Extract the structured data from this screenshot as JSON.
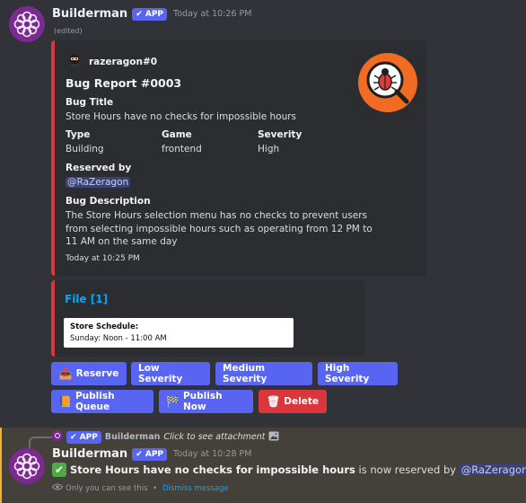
{
  "message1": {
    "author": "Builderman",
    "app_badge": "APP",
    "timestamp": "Today at 10:26 PM",
    "edited": "(edited)"
  },
  "embed": {
    "author": "razeragon#0",
    "title": "Bug Report #0003",
    "bug_title_label": "Bug Title",
    "bug_title_value": "Store Hours have no checks for impossible hours",
    "type_label": "Type",
    "type_value": "Building",
    "game_label": "Game",
    "game_value": "frontend",
    "severity_label": "Severity",
    "severity_value": "High",
    "reserved_label": "Reserved by",
    "reserved_value": "@RaZeragon",
    "desc_label": "Bug Description",
    "desc_line1": "The Store Hours selection menu has no checks to prevent users",
    "desc_line2": "from selecting impossible hours such as operating from 12 PM to",
    "desc_line3": "11 AM on the same day",
    "footer": "Today at 10:25 PM",
    "accent": "#da373c"
  },
  "file_embed": {
    "title": "File [1]",
    "schedule_title": "Store Schedule:",
    "schedule_line": "Sunday: Noon - 11:00 AM"
  },
  "buttons": {
    "reserve": "Reserve",
    "low": "Low Severity",
    "medium": "Medium Severity",
    "high": "High Severity",
    "publish_queue": "Publish Queue",
    "publish_now": "Publish Now",
    "delete": "Delete"
  },
  "reply": {
    "badge": "APP",
    "author": "Builderman",
    "text": "Click to see attachment"
  },
  "message2": {
    "author": "Builderman",
    "app_badge": "APP",
    "timestamp": "Today at 10:28 PM",
    "bold_text": "Store Hours have no checks for impossible hours",
    "rest_text": " is now reserved by ",
    "mention": "@RaZeragon",
    "period": ".",
    "ephemeral_note": "Only you can see this",
    "separator": " • ",
    "dismiss": "Dismiss message"
  },
  "colors": {
    "background": "#313338",
    "embed_bg": "#2b2d31",
    "blurple": "#5865f2",
    "danger": "#da373c",
    "highlight": "#44403a"
  }
}
